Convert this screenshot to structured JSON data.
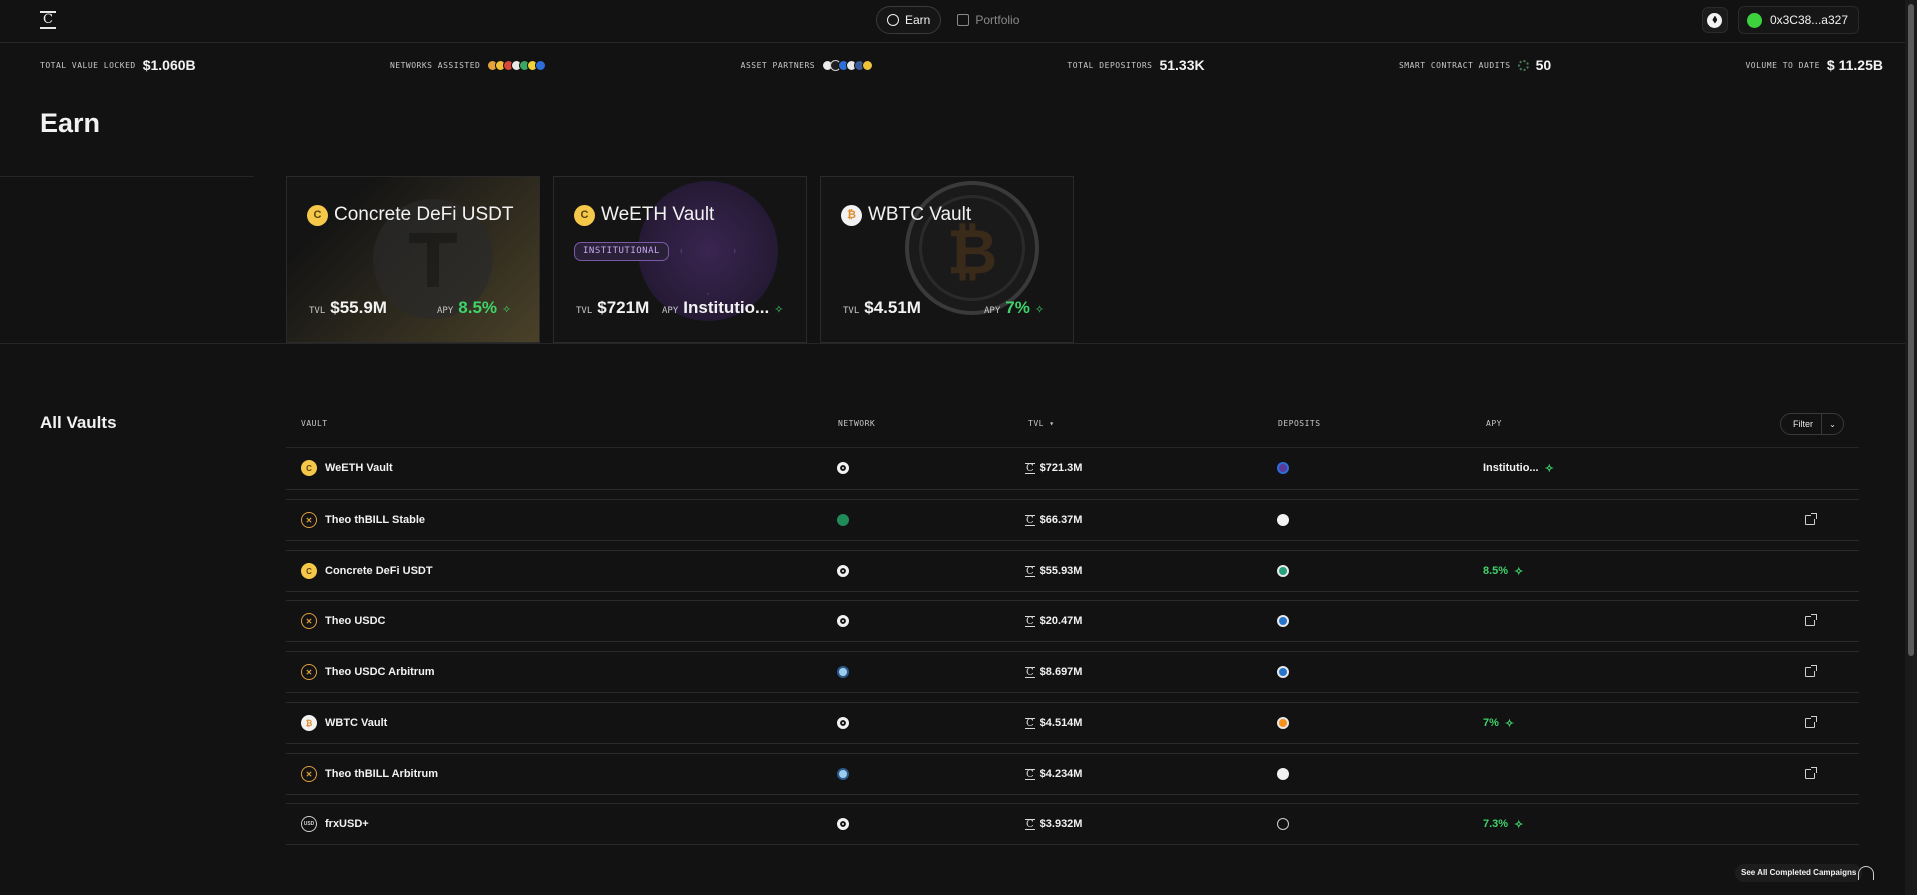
{
  "nav": {
    "logo": "C",
    "tabs": [
      {
        "label": "Earn",
        "active": true,
        "icon": "earn-coin-icon"
      },
      {
        "label": "Portfolio",
        "active": false,
        "icon": "portfolio-icon"
      }
    ],
    "network_icon": "ethereum-icon",
    "wallet_address": "0x3C38...a327"
  },
  "stats": [
    {
      "label": "TOTAL VALUE LOCKED",
      "value": "$1.060B"
    },
    {
      "label": "NETWORKS ASSISTED",
      "value": ""
    },
    {
      "label": "ASSET PARTNERS",
      "value": ""
    },
    {
      "label": "TOTAL DEPOSITORS",
      "value": "51.33K"
    },
    {
      "label": "SMART CONTRACT AUDITS",
      "value": "50"
    },
    {
      "label": "VOLUME TO DATE",
      "value": "$ 11.25B"
    }
  ],
  "page_title": "Earn",
  "featured": [
    {
      "name": "Concrete DeFi USDT",
      "tvl_label": "TVL",
      "tvl": "$55.9M",
      "apy_label": "APY",
      "apy": "8.5%"
    },
    {
      "name": "WeETH Vault",
      "badge": "INSTITUTIONAL",
      "tvl_label": "TVL",
      "tvl": "$721M",
      "apy_label": "APY",
      "apy": "Institutio..."
    },
    {
      "name": "WBTC Vault",
      "tvl_label": "TVL",
      "tvl": "$4.51M",
      "apy_label": "APY",
      "apy": "7%"
    }
  ],
  "table": {
    "title": "All Vaults",
    "headers": {
      "vault": "VAULT",
      "network": "NETWORK",
      "tvl": "TVL ▾",
      "deposits": "DEPOSITS",
      "apy": "APY"
    },
    "filter_label": "Filter",
    "rows": [
      {
        "name": "WeETH Vault",
        "tvl": "$721.3M",
        "apy": "Institutio..."
      },
      {
        "name": "Theo thBILL Stable",
        "tvl": "$66.37M",
        "apy": ""
      },
      {
        "name": "Concrete DeFi USDT",
        "tvl": "$55.93M",
        "apy": "8.5%"
      },
      {
        "name": "Theo USDC",
        "tvl": "$20.47M",
        "apy": ""
      },
      {
        "name": "Theo USDC Arbitrum",
        "tvl": "$8.697M",
        "apy": ""
      },
      {
        "name": "WBTC Vault",
        "tvl": "$4.514M",
        "apy": "7%"
      },
      {
        "name": "Theo thBILL Arbitrum",
        "tvl": "$4.234M",
        "apy": ""
      },
      {
        "name": "frxUSD+",
        "tvl": "$3.932M",
        "apy": "7.3%"
      }
    ]
  },
  "footer": {
    "completed_label": "See All Completed Campaigns"
  },
  "colors": {
    "accent_green": "#3fd36a",
    "background": "#121212",
    "institutional_purple": "#c7a8f2"
  }
}
